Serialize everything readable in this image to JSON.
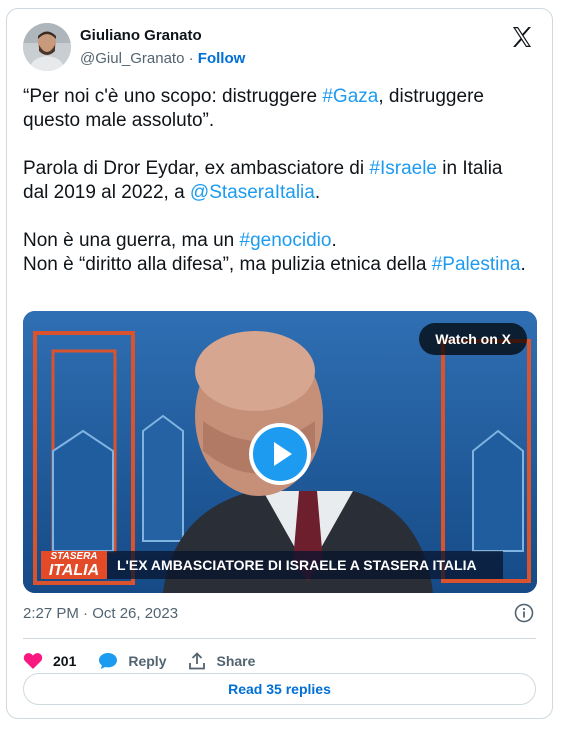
{
  "author": {
    "name": "Giuliano Granato",
    "handle": "@Giul_Granato",
    "separator": "·",
    "follow_label": "Follow"
  },
  "tweet": {
    "p1": {
      "t1": "“Per noi c'è uno scopo: distruggere ",
      "tag1": "#Gaza",
      "t2": ", distruggere questo male assoluto”."
    },
    "p2": {
      "t1": "Parola di Dror Eydar, ex ambasciatore di ",
      "tag1": "#Israele",
      "t2": " in Italia dal 2019 al 2022, a ",
      "tag2": "@StaseraItalia",
      "t3": "."
    },
    "p3": {
      "t1": "Non è una guerra, ma un ",
      "tag1": "#genocidio",
      "t2": ".",
      "t3": "Non è “diritto alla difesa”, ma pulizia etnica della ",
      "tag2": "#Palestina",
      "t4": "."
    }
  },
  "media": {
    "watch_label": "Watch on X",
    "ticker_brand_top": "STASERA",
    "ticker_brand_bottom": "ITALIA",
    "ticker_headline": "L'EX AMBASCIATORE DI ISRAELE A STASERA ITALIA",
    "backdrop_text": "STASERA ITALIA"
  },
  "meta": {
    "timestamp": "2:27 PM · Oct 26, 2023"
  },
  "actions": {
    "likes": "201",
    "reply_label": "Reply",
    "share_label": "Share"
  },
  "read_replies_label": "Read 35 replies",
  "colors": {
    "link": "#1d9bf0",
    "follow": "#006fd6",
    "like": "#f91880",
    "muted": "#536471",
    "border": "#cfd9de"
  }
}
